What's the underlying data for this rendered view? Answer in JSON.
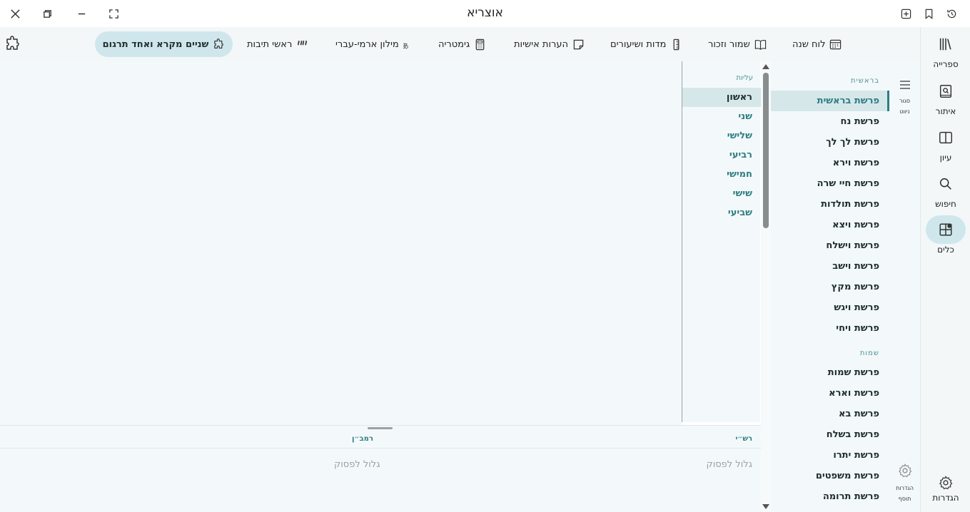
{
  "window": {
    "title": "אוצריא"
  },
  "rail": {
    "items": [
      {
        "label": "ספרייה",
        "icon": "library-icon"
      },
      {
        "label": "איתור",
        "icon": "find-book-icon"
      },
      {
        "label": "עיון",
        "icon": "open-book-icon"
      },
      {
        "label": "חיפוש",
        "icon": "search-icon"
      },
      {
        "label": "כלים",
        "icon": "tools-icon"
      }
    ],
    "settings_label": "הגדרות",
    "active": "כלים"
  },
  "toolbar": {
    "luach": "לוח שנה",
    "shamor": "שמור וזכור",
    "midot": "מדות ושיעורים",
    "notes": "הערות אישיות",
    "gematria": "גימטריה",
    "dictionary": "מילון ארמי-עברי",
    "acronyms": "ראשי תיבות",
    "active_tool": "שניים מקרא ואחד תרגום"
  },
  "aliyot": {
    "header": "עליות",
    "items": [
      "ראשון",
      "שני",
      "שלישי",
      "רביעי",
      "חמישי",
      "שישי",
      "שביעי"
    ],
    "active": "ראשון"
  },
  "parshiot": {
    "books": [
      {
        "name": "בראשית",
        "items": [
          "פרשת בראשית",
          "פרשת נח",
          "פרשת לך לך",
          "פרשת וירא",
          "פרשת חיי שרה",
          "פרשת תולדות",
          "פרשת ויצא",
          "פרשת וישלח",
          "פרשת וישב",
          "פרשת מקץ",
          "פרשת ויגש",
          "פרשת ויחי"
        ]
      },
      {
        "name": "שמות",
        "items": [
          "פרשת שמות",
          "פרשת וארא",
          "פרשת בא",
          "פרשת בשלח",
          "פרשת יתרו",
          "פרשת משפטים",
          "פרשת תרומה"
        ]
      }
    ],
    "active": "פרשת בראשית"
  },
  "mini": {
    "nav_line1": "סגור",
    "nav_line2": "ניווט",
    "settings_line1": "הגדרות",
    "settings_line2": "תוסף"
  },
  "commentary": {
    "right_title": "רש״י",
    "right_empty": "גלול לפסוק",
    "left_title": "רמב״ן",
    "left_empty": "גלול לפסוק"
  },
  "colors": {
    "accent": "#2f7d82",
    "active_bg": "#cfe7ec",
    "panel_bg": "#f3f9fb"
  }
}
